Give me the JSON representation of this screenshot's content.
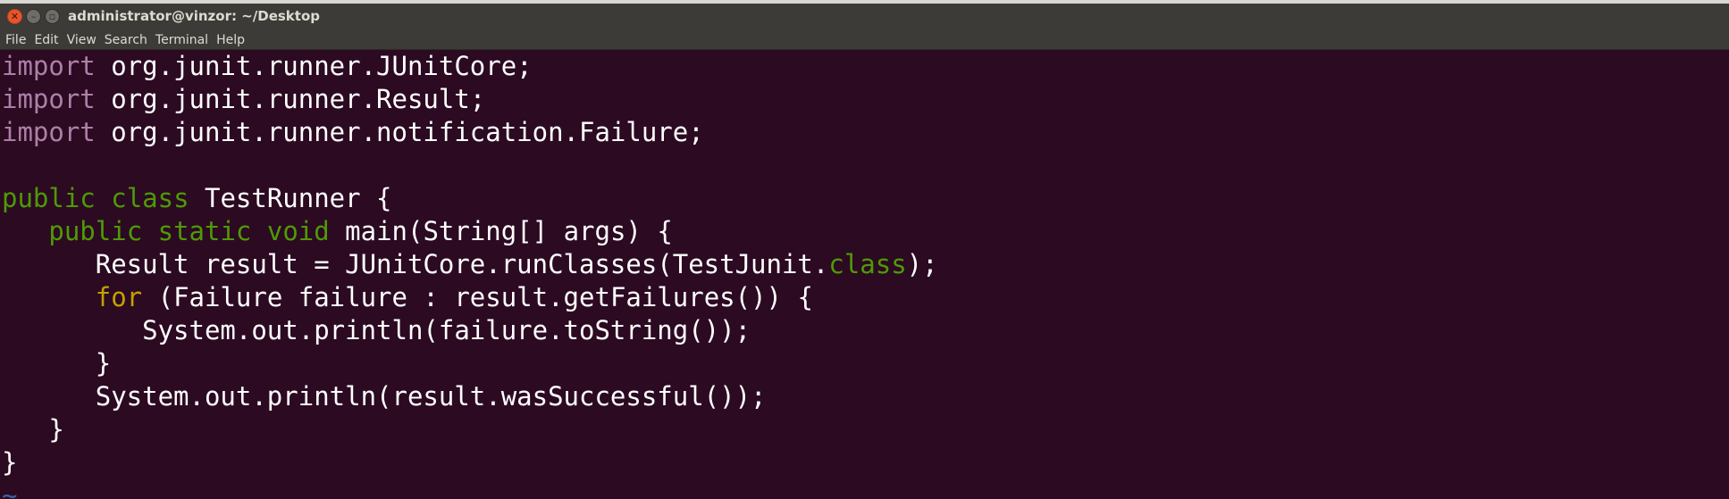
{
  "window": {
    "title": "administrator@vinzor: ~/Desktop"
  },
  "menu": [
    "File",
    "Edit",
    "View",
    "Search",
    "Terminal",
    "Help"
  ],
  "icons": {
    "close": "close-icon",
    "minimize": "minimize-icon",
    "maximize": "maximize-icon"
  },
  "colors": {
    "terminal_bg": "#2c0a22",
    "titlebar_bg": "#3c3b37",
    "import_keyword": "#ad7fa8",
    "java_keyword": "#4e9a06",
    "for_keyword": "#c4a000",
    "text": "#ffffff",
    "tilde": "#3465a4"
  },
  "editor": {
    "lines": [
      [
        {
          "t": "import",
          "c": "kw-import"
        },
        {
          "t": " org.junit.runner.JUnitCore;"
        }
      ],
      [
        {
          "t": "import",
          "c": "kw-import"
        },
        {
          "t": " org.junit.runner.Result;"
        }
      ],
      [
        {
          "t": "import",
          "c": "kw-import"
        },
        {
          "t": " org.junit.runner.notification.Failure;"
        }
      ],
      [],
      [
        {
          "t": "public",
          "c": "kw-green"
        },
        {
          "t": " "
        },
        {
          "t": "class",
          "c": "kw-green"
        },
        {
          "t": " TestRunner {"
        }
      ],
      [
        {
          "t": "   "
        },
        {
          "t": "public",
          "c": "kw-green"
        },
        {
          "t": " "
        },
        {
          "t": "static",
          "c": "kw-green"
        },
        {
          "t": " "
        },
        {
          "t": "void",
          "c": "kw-green"
        },
        {
          "t": " main(String[] args) {"
        }
      ],
      [
        {
          "t": "      Result result = JUnitCore.runClasses(TestJunit."
        },
        {
          "t": "class",
          "c": "kw-green"
        },
        {
          "t": ");"
        }
      ],
      [
        {
          "t": "      "
        },
        {
          "t": "for",
          "c": "kw-for"
        },
        {
          "t": " (Failure failure : result.getFailures()) {"
        }
      ],
      [
        {
          "t": "         System.out.println(failure.toString());"
        }
      ],
      [
        {
          "t": "      }"
        }
      ],
      [
        {
          "t": "      System.out.println(result.wasSuccessful());"
        }
      ],
      [
        {
          "t": "   }"
        }
      ],
      [
        {
          "t": "}"
        }
      ],
      [
        {
          "t": "~",
          "c": "tilde"
        }
      ]
    ]
  }
}
